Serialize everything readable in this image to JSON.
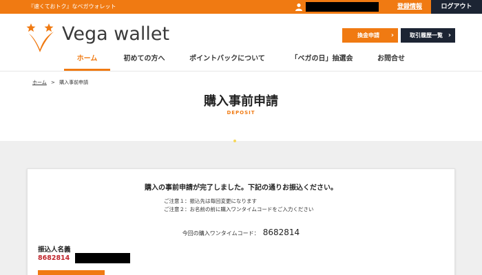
{
  "topbar": {
    "tagline": "『速くておトク』なベガウォレット",
    "register_label": "登録情報",
    "logout_label": "ログアウト"
  },
  "header": {
    "logo_text": "Vega wallet",
    "exchange_button": "換金申請",
    "history_button": "取引履歴一覧"
  },
  "nav": {
    "items": [
      {
        "label": "ホーム",
        "active": true
      },
      {
        "label": "初めての方へ",
        "active": false
      },
      {
        "label": "ポイントバックについて",
        "active": false
      },
      {
        "label": "「ベガの日」抽選会",
        "active": false
      },
      {
        "label": "お問合せ",
        "active": false
      }
    ]
  },
  "breadcrumb": {
    "home": "ホーム",
    "separator": ">",
    "current": "購入事前申請"
  },
  "page": {
    "title": "購入事前申請",
    "subtitle": "DEPOSIT"
  },
  "card": {
    "heading": "購入の事前申請が完了しました。下記の通りお振込ください。",
    "note1": "ご注意１：振込先は毎回変更になります",
    "note2": "ご注意２：お名前の前に購入ワンタイムコードをご入力ください",
    "code_label": "今回の購入ワンタイムコード：",
    "code_value": "8682814",
    "payer_label": "振込人名義",
    "payer_code": "8682814"
  },
  "colors": {
    "accent": "#f07a12",
    "dark": "#1c2433",
    "red": "#c0262d"
  }
}
